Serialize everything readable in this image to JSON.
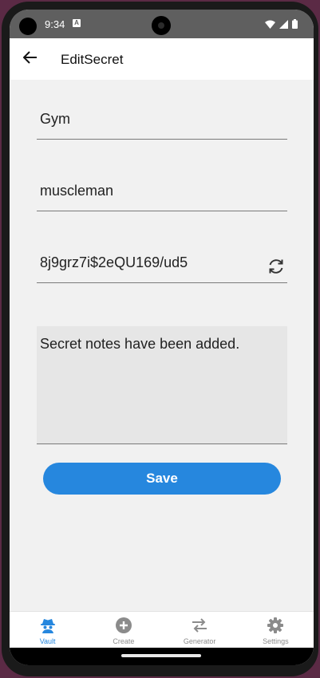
{
  "status": {
    "time": "9:34",
    "notification_badge": "A"
  },
  "appbar": {
    "title": "EditSecret"
  },
  "form": {
    "name_value": "Gym",
    "username_value": "muscleman",
    "password_value": "8j9grz7i$2eQU169/ud5",
    "notes_value": "Secret notes have been added.",
    "save_label": "Save"
  },
  "bottom_nav": {
    "items": [
      {
        "label": "Vault",
        "icon": "spy-icon",
        "active": true
      },
      {
        "label": "Create",
        "icon": "plus-circle-icon",
        "active": false
      },
      {
        "label": "Generator",
        "icon": "swap-arrows-icon",
        "active": false
      },
      {
        "label": "Settings",
        "icon": "gear-icon",
        "active": false
      }
    ]
  },
  "colors": {
    "accent": "#2687de",
    "background": "#f1f1f1",
    "status_bar": "#5f5f5f"
  }
}
